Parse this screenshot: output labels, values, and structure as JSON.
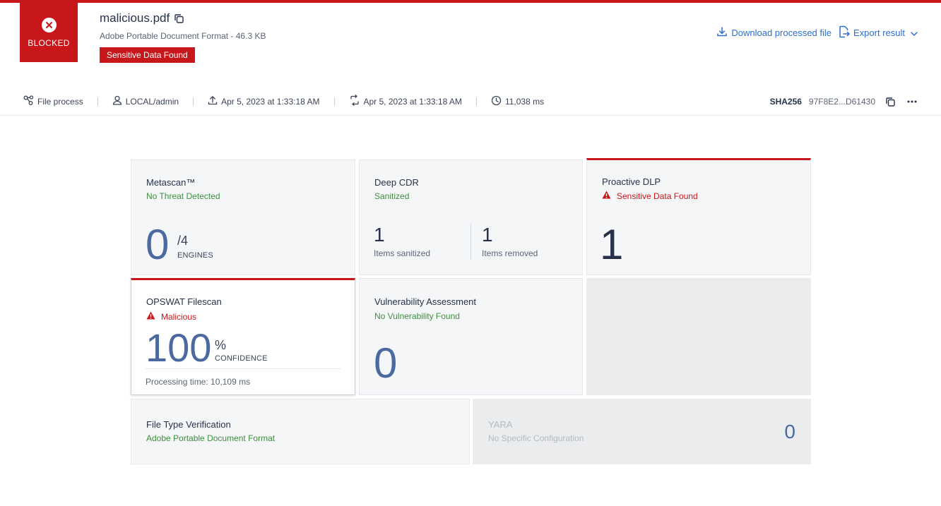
{
  "header": {
    "blocked_label": "BLOCKED",
    "file_name": "malicious.pdf",
    "file_subtitle": "Adobe Portable Document Format - 46.3 KB",
    "sensitive_badge": "Sensitive Data Found",
    "download_label": "Download processed file",
    "export_label": "Export result",
    "accent_color": "#c8171b",
    "link_color": "#2c6fd1"
  },
  "meta": {
    "process": "File process",
    "user": "LOCAL/admin",
    "uploaded": "Apr 5, 2023 at 1:33:18 AM",
    "processed": "Apr 5, 2023 at 1:33:18 AM",
    "duration": "11,038 ms",
    "sha_label": "SHA256",
    "sha_value": "97F8E2...D61430"
  },
  "cards": {
    "metascan": {
      "title": "Metascan™",
      "status": "No Threat Detected",
      "value": "0",
      "total": "/4",
      "unit_label": "ENGINES"
    },
    "deepcdr": {
      "title": "Deep CDR",
      "status": "Sanitized",
      "sanitized_value": "1",
      "sanitized_label": "Items sanitized",
      "removed_value": "1",
      "removed_label": "Items removed"
    },
    "dlp": {
      "title": "Proactive DLP",
      "status": "Sensitive Data Found",
      "value": "1"
    },
    "filescan": {
      "title": "OPSWAT Filescan",
      "status": "Malicious",
      "value": "100",
      "unit": "%",
      "unit_label": "CONFIDENCE",
      "processing": "Processing time: 10,109 ms"
    },
    "vuln": {
      "title": "Vulnerability Assessment",
      "status": "No Vulnerability Found",
      "value": "0"
    },
    "filetype": {
      "title": "File Type Verification",
      "status": "Adobe Portable Document Format"
    },
    "yara": {
      "title": "YARA",
      "status": "No Specific Configuration",
      "value": "0"
    }
  },
  "icons": [
    "close-icon",
    "copy-icon",
    "download-icon",
    "export-icon",
    "chevron-down-icon",
    "process-icon",
    "user-icon",
    "upload-icon",
    "sync-icon",
    "clock-icon",
    "more-icon",
    "warning-icon"
  ]
}
